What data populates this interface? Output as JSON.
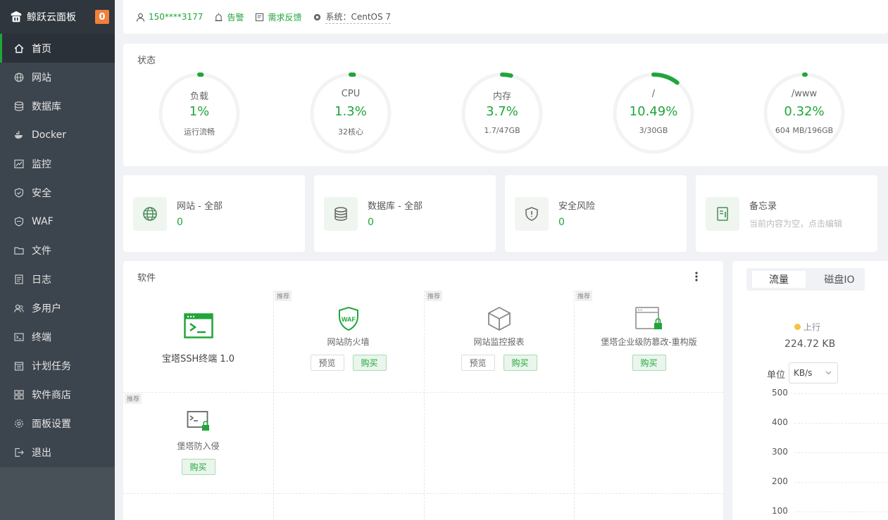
{
  "sidebar": {
    "brand": "鲸跃云面板",
    "badge": "0",
    "items": [
      {
        "label": "首页",
        "icon": "home-icon"
      },
      {
        "label": "网站",
        "icon": "globe-icon"
      },
      {
        "label": "数据库",
        "icon": "database-icon"
      },
      {
        "label": "Docker",
        "icon": "docker-icon"
      },
      {
        "label": "监控",
        "icon": "monitor-icon"
      },
      {
        "label": "安全",
        "icon": "shield-icon"
      },
      {
        "label": "WAF",
        "icon": "waf-shield-icon"
      },
      {
        "label": "文件",
        "icon": "folder-icon"
      },
      {
        "label": "日志",
        "icon": "log-icon"
      },
      {
        "label": "多用户",
        "icon": "users-icon"
      },
      {
        "label": "终端",
        "icon": "terminal-icon"
      },
      {
        "label": "计划任务",
        "icon": "calendar-icon"
      },
      {
        "label": "软件商店",
        "icon": "grid-icon"
      },
      {
        "label": "面板设置",
        "icon": "gear-icon"
      },
      {
        "label": "退出",
        "icon": "logout-icon"
      }
    ]
  },
  "topbar": {
    "user": "150****3177",
    "alarm": "告警",
    "feedback": "需求反馈",
    "system": "系统：CentOS 7"
  },
  "status": {
    "title": "状态",
    "gauges": [
      {
        "name": "负载",
        "value": "1%",
        "sub": "运行流畅",
        "fraction": 0.01
      },
      {
        "name": "CPU",
        "value": "1.3%",
        "sub": "32核心",
        "fraction": 0.013
      },
      {
        "name": "内存",
        "value": "3.7%",
        "sub": "1.7/47GB",
        "fraction": 0.037
      },
      {
        "name": "/",
        "value": "10.49%",
        "sub": "3/30GB",
        "fraction": 0.1049
      },
      {
        "name": "/www",
        "value": "0.32%",
        "sub": "604 MB/196GB",
        "fraction": 0.0032
      }
    ]
  },
  "cards": {
    "site": {
      "title": "网站 - 全部",
      "value": "0"
    },
    "db": {
      "title": "数据库 - 全部",
      "value": "0"
    },
    "risk": {
      "title": "安全风险",
      "value": "0"
    },
    "memo": {
      "title": "备忘录",
      "note": "当前内容为空，点击编辑"
    }
  },
  "software": {
    "title": "软件",
    "tag": "推荐",
    "preview": "预览",
    "buy": "购买",
    "items": [
      {
        "name": "宝塔SSH终端 1.0"
      },
      {
        "name": "网站防火墙"
      },
      {
        "name": "网站监控报表"
      },
      {
        "name": "堡塔企业级防篡改-重构版"
      },
      {
        "name": "堡塔防入侵"
      }
    ]
  },
  "traffic": {
    "tab_traffic": "流量",
    "tab_disk": "磁盘IO",
    "legend_up": "上行",
    "up_value": "224.72 KB",
    "unit_label": "单位",
    "unit_value": "KB/s",
    "y_ticks": [
      "500",
      "400",
      "300",
      "200",
      "100"
    ]
  },
  "colors": {
    "accent": "#20a53a",
    "sidebar": "#3c444d",
    "badge": "#f0803c",
    "legend_up": "#f5c342"
  }
}
